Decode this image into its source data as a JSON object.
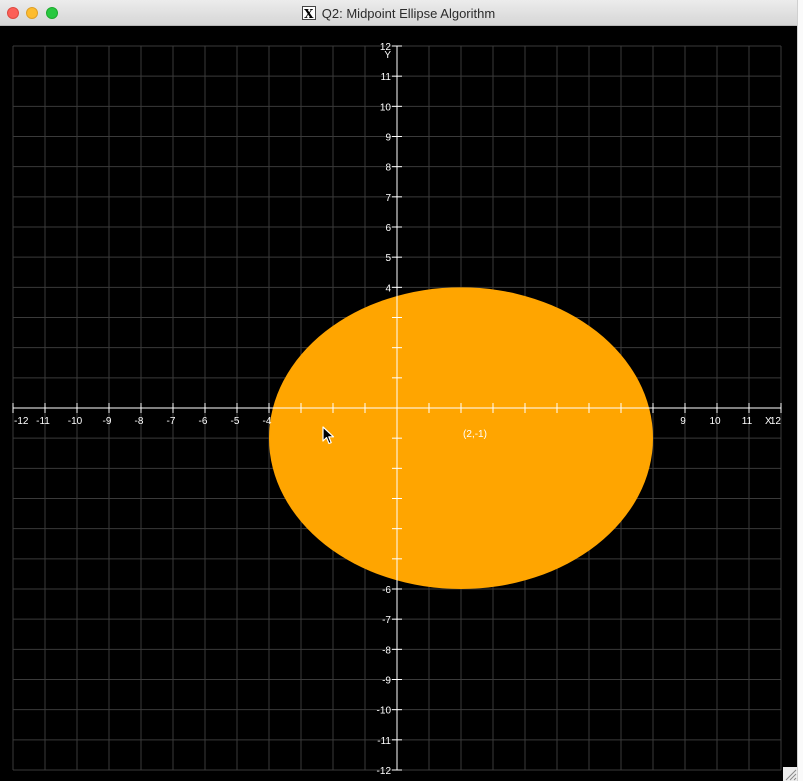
{
  "window": {
    "title": "Q2: Midpoint Ellipse Algorithm",
    "app_icon_glyph": "X",
    "controls": [
      "close-button",
      "minimize-button",
      "zoom-button"
    ]
  },
  "plot": {
    "x_range": [
      -12,
      12
    ],
    "y_range": [
      -12,
      12
    ],
    "x_axis_label": "X",
    "y_axis_label": "Y",
    "grid": true,
    "axis_color": "#ffffff",
    "grid_color": "#3a3a3a",
    "background_color": "#000000",
    "x_tick_labels": [
      {
        "v": -12,
        "t": "-12"
      },
      {
        "v": -11,
        "t": "-11"
      },
      {
        "v": -10,
        "t": "-10"
      },
      {
        "v": -9,
        "t": "-9"
      },
      {
        "v": -8,
        "t": "-8"
      },
      {
        "v": -7,
        "t": "-7"
      },
      {
        "v": -6,
        "t": "-6"
      },
      {
        "v": -5,
        "t": "-5"
      },
      {
        "v": -4,
        "t": "-4"
      },
      {
        "v": 9,
        "t": "9"
      },
      {
        "v": 10,
        "t": "10"
      },
      {
        "v": 11,
        "t": "11"
      },
      {
        "v": 12,
        "t": "12"
      }
    ],
    "y_tick_labels": [
      {
        "v": 12,
        "t": "12"
      },
      {
        "v": 11,
        "t": "11"
      },
      {
        "v": 10,
        "t": "10"
      },
      {
        "v": 9,
        "t": "9"
      },
      {
        "v": 8,
        "t": "8"
      },
      {
        "v": 7,
        "t": "7"
      },
      {
        "v": 6,
        "t": "6"
      },
      {
        "v": 5,
        "t": "5"
      },
      {
        "v": 4,
        "t": "4"
      },
      {
        "v": -6,
        "t": "-6"
      },
      {
        "v": -7,
        "t": "-7"
      },
      {
        "v": -8,
        "t": "-8"
      },
      {
        "v": -9,
        "t": "-9"
      },
      {
        "v": -10,
        "t": "-10"
      },
      {
        "v": -11,
        "t": "-11"
      },
      {
        "v": -12,
        "t": "-12"
      }
    ],
    "ellipse": {
      "center": [
        2,
        -1
      ],
      "rx": 6,
      "ry": 5,
      "fill_color": "#ffa500",
      "center_label": "(2,-1)"
    }
  },
  "cursor": {
    "icon": "mouse-pointer-icon"
  }
}
